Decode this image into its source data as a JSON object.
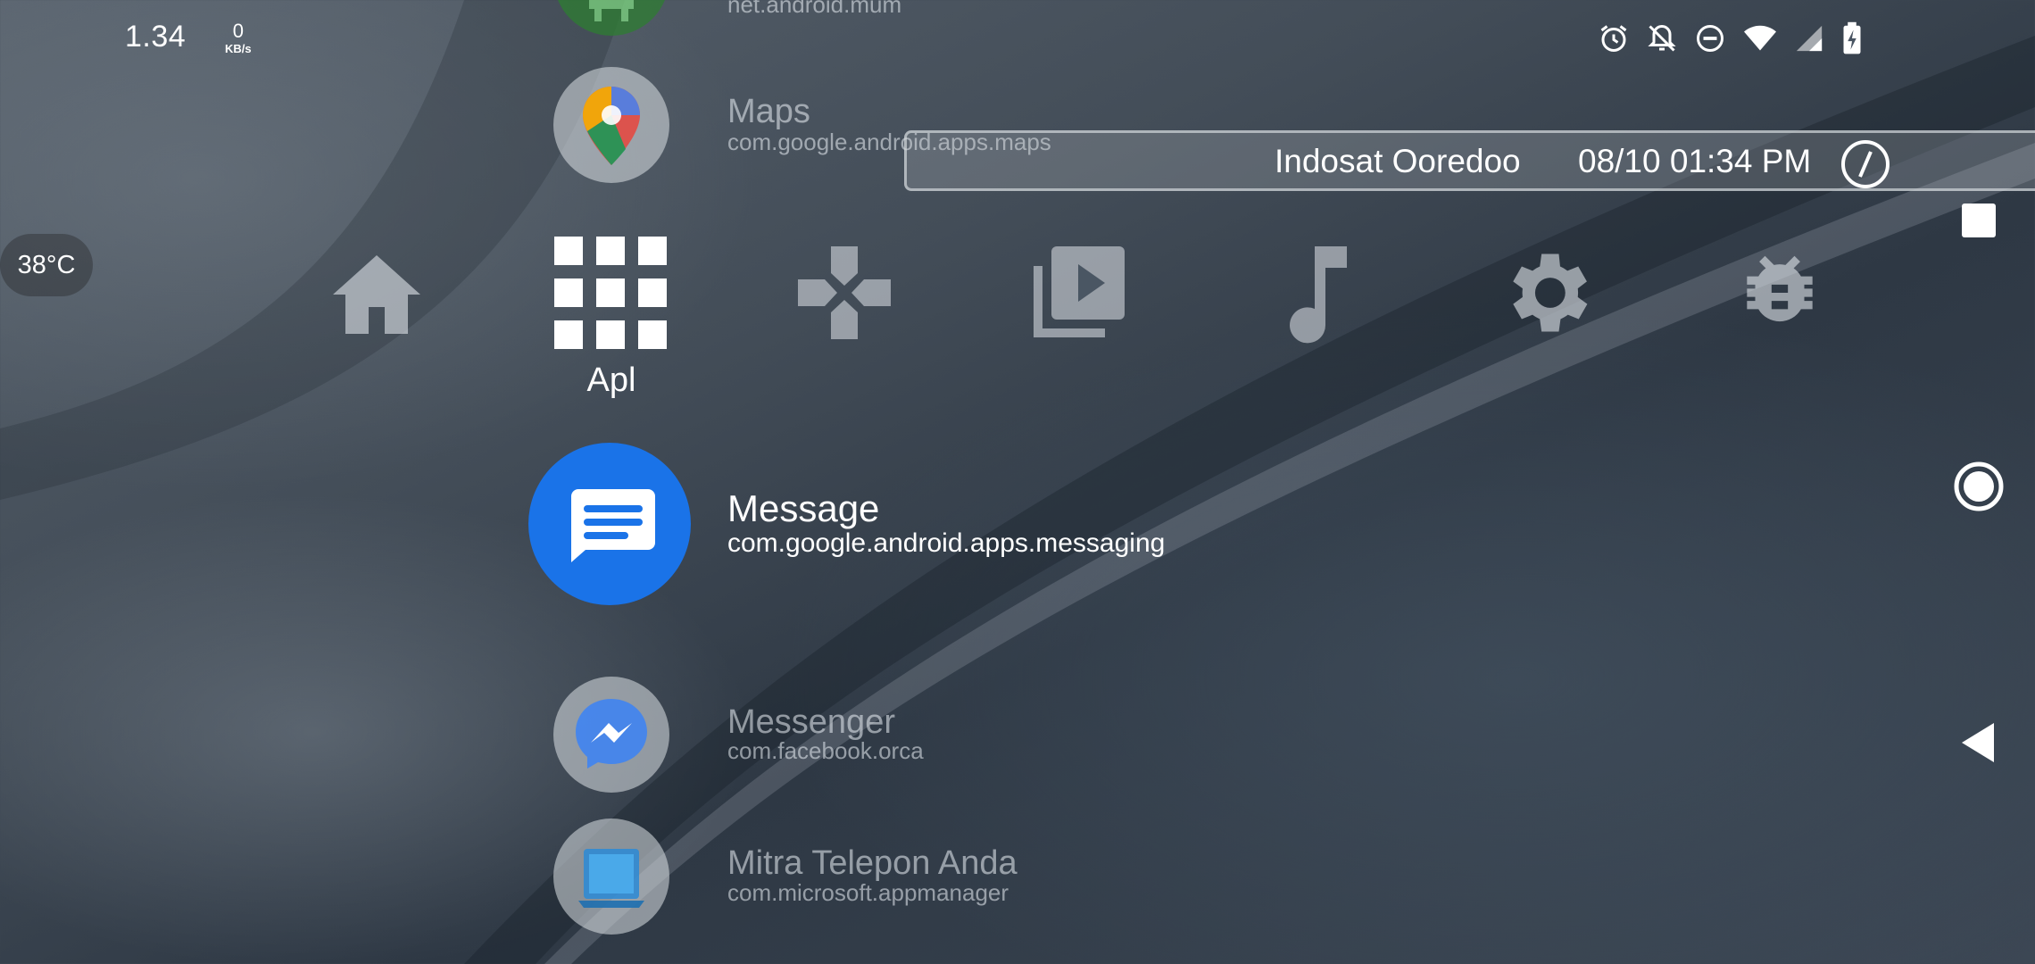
{
  "status_bar": {
    "clock": "1.34",
    "net_speed_value": "0",
    "net_speed_unit": "KB/s",
    "icons": [
      "alarm-icon",
      "bell-off-icon",
      "do-not-disturb-icon",
      "wifi-icon",
      "signal-icon",
      "battery-charging-icon"
    ]
  },
  "temperature": "38°C",
  "banner": {
    "carrier": "Indosat Ooredoo",
    "datetime": "08/10 01:34 PM"
  },
  "dock": {
    "items": [
      {
        "icon": "home-icon"
      },
      {
        "icon": "apps-grid-icon",
        "label": "Apl"
      },
      {
        "icon": "gamepad-icon"
      },
      {
        "icon": "video-library-icon"
      },
      {
        "icon": "music-note-icon"
      },
      {
        "icon": "settings-gear-icon"
      },
      {
        "icon": "bug-icon"
      }
    ]
  },
  "apps": [
    {
      "name": "",
      "package": "net.android.mum",
      "icon": "android-icon"
    },
    {
      "name": "Maps",
      "package": "com.google.android.apps.maps",
      "icon": "maps-pin-icon"
    },
    {
      "name": "Message",
      "package": "com.google.android.apps.messaging",
      "icon": "messages-icon",
      "selected": true
    },
    {
      "name": "Messenger",
      "package": "com.facebook.orca",
      "icon": "messenger-icon"
    },
    {
      "name": "Mitra Telepon Anda",
      "package": "com.microsoft.appmanager",
      "icon": "phone-link-icon"
    }
  ],
  "nav": [
    "recents-square-icon",
    "home-circle-icon",
    "back-triangle-icon"
  ],
  "colors": {
    "accent_blue": "#1a73e8",
    "selected_text": "#ffffff"
  }
}
